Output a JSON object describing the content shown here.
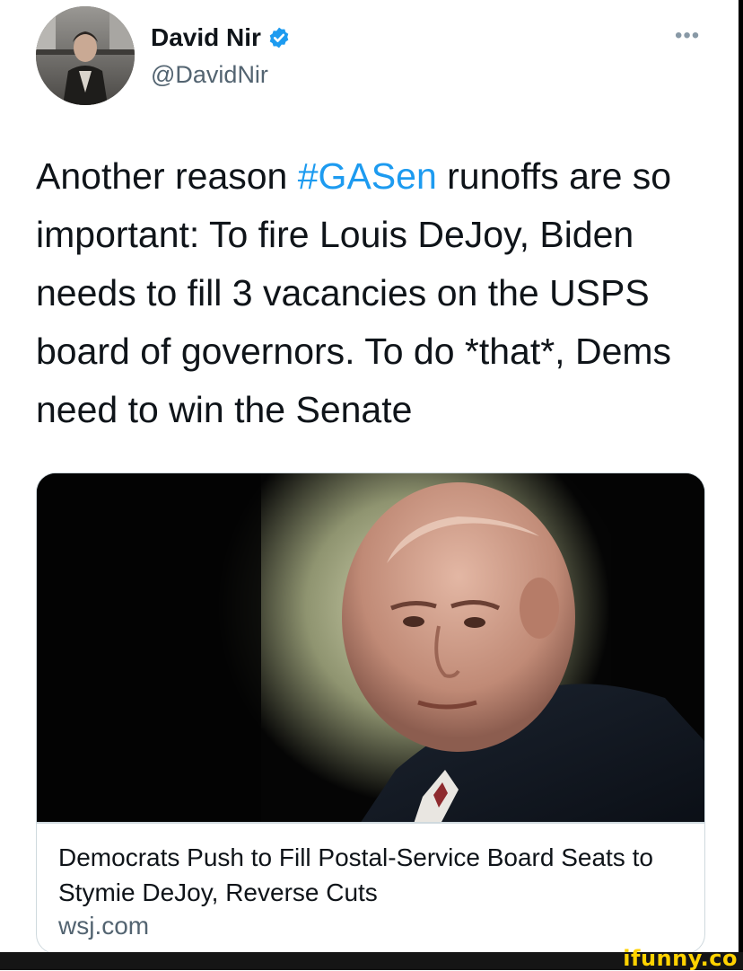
{
  "author": {
    "display_name": "David Nir",
    "handle": "@DavidNir",
    "verified_icon": "verified-badge-icon",
    "more_icon": "more-options-icon",
    "more_glyph": "•••"
  },
  "tweet": {
    "text_before_hashtag": "Another reason ",
    "hashtag": "#GASen",
    "text_after_hashtag": " runoffs are so important: To fire Louis DeJoy, Biden needs to fill 3 vacancies on the USPS board of governors. To do *that*, Dems need to win the Senate"
  },
  "link_card": {
    "title": "Democrats Push to Fill Postal-Service Board Seats to Stymie DeJoy, Reverse Cuts",
    "domain": "wsj.com"
  },
  "watermark": {
    "text": "ifunny.co"
  },
  "colors": {
    "link_blue": "#1d9bf0",
    "secondary_text": "#536471",
    "watermark_yellow": "#ffd200"
  }
}
